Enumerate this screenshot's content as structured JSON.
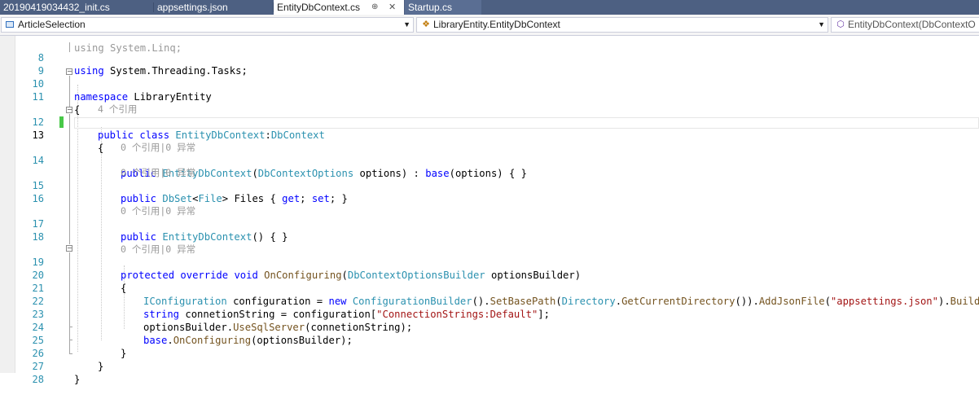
{
  "tabs": [
    {
      "label": "20190419034432_init.cs"
    },
    {
      "label": "appsettings.json"
    },
    {
      "label": "EntityDbContext.cs",
      "pin_icon": "pin-icon",
      "close_icon": "close-icon"
    },
    {
      "label": "Startup.cs"
    }
  ],
  "navbar": {
    "project": "ArticleSelection",
    "type": "LibraryEntity.EntityDbContext",
    "member": "EntityDbContext(DbContextO"
  },
  "lines": {
    "l7": {
      "text": "using System.Linq;"
    },
    "l8": {
      "num": "8",
      "kw": "using",
      "rest": " System.Threading.Tasks;"
    },
    "l9": {
      "num": "9"
    },
    "l10": {
      "num": "10",
      "kw": "namespace",
      "rest": " LibraryEntity"
    },
    "l11": {
      "num": "11",
      "text": "{"
    },
    "lens_class": "4 个引用",
    "l12": {
      "num": "12",
      "kw1": "public",
      "kw2": "class",
      "type1": "EntityDbContext",
      "sep": ":",
      "type2": "DbContext"
    },
    "l13": {
      "num": "13",
      "text": "{"
    },
    "lens_ctor": "0 个引用|0 异常",
    "l14": {
      "num": "14",
      "kw1": "public",
      "type1": "EntityDbContext",
      "p1": "(",
      "type2": "DbContextOptions",
      "p2": " options) : ",
      "kw2": "base",
      "p3": "(options) { }"
    },
    "lens_files": "0 个引用|0 异常",
    "l15": {
      "num": "15",
      "kw1": "public",
      "type1": "DbSet",
      "p1": "<",
      "type2": "File",
      "p2": "> Files { ",
      "kw2": "get",
      "p3": "; ",
      "kw3": "set",
      "p4": "; }"
    },
    "l16": {
      "num": "16"
    },
    "lens_ctor2": "0 个引用|0 异常",
    "l17": {
      "num": "17",
      "kw1": "public",
      "type1": "EntityDbContext",
      "p1": "() { }"
    },
    "l18": {
      "num": "18"
    },
    "lens_onconf": "0 个引用|0 异常",
    "l19": {
      "num": "19",
      "kw1": "protected",
      "kw2": "override",
      "kw3": "void",
      "m1": "OnConfiguring",
      "p1": "(",
      "type1": "DbContextOptionsBuilder",
      "p2": " optionsBuilder)"
    },
    "l20": {
      "num": "20",
      "text": "{"
    },
    "l21": {
      "num": "21",
      "type1": "IConfiguration",
      "p1": " configuration = ",
      "kw1": "new",
      "type2": "ConfigurationBuilder",
      "p2": "().",
      "m1": "SetBasePath",
      "p3": "(",
      "type3": "Directory",
      "p4": ".",
      "m2": "GetCurrentDirectory",
      "p5": "()).",
      "m3": "AddJsonFile",
      "p6": "(",
      "s1": "\"appsettings.json\"",
      "p7": ").",
      "m4": "Build",
      "p8": "();"
    },
    "l22": {
      "num": "22",
      "kw1": "string",
      "p1": " connetionString = configuration[",
      "s1": "\"ConnectionStrings:Default\"",
      "p2": "];"
    },
    "l23": {
      "num": "23",
      "p0": "optionsBuilder.",
      "m1": "UseSqlServer",
      "p1": "(connetionString);"
    },
    "l24": {
      "num": "24",
      "kw1": "base",
      "p0": ".",
      "m1": "OnConfiguring",
      "p1": "(optionsBuilder);"
    },
    "l25": {
      "num": "25",
      "text": "}"
    },
    "l26": {
      "num": "26",
      "text": "}"
    },
    "l27": {
      "num": "27",
      "text": "}"
    },
    "l28": {
      "num": "28"
    }
  },
  "colors": {
    "tab_bar": "#4d6082",
    "keyword": "#0000ff",
    "type": "#2b91af",
    "string": "#a31515",
    "method": "#74531f",
    "line_number": "#2b91af",
    "change_bar": "#48c848"
  }
}
